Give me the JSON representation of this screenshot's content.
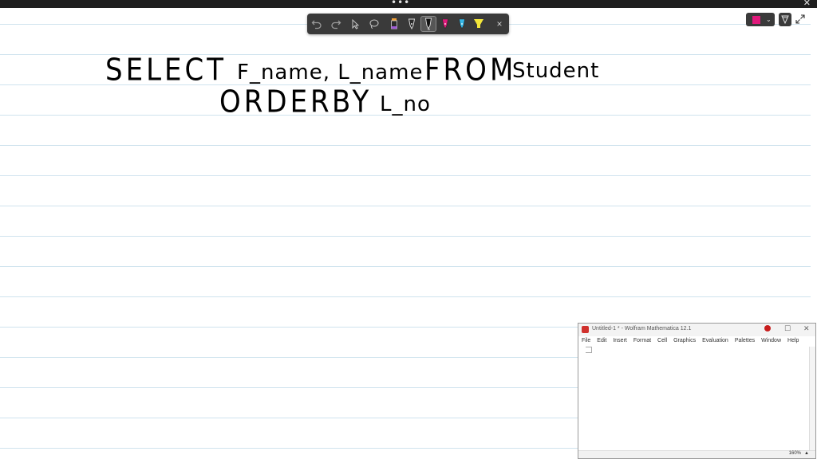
{
  "topbar": {
    "dots": "•••",
    "close": "✕"
  },
  "toolbar": {
    "tools": [
      "undo-icon",
      "redo-icon",
      "select-icon",
      "lasso-icon",
      "pen-orange-icon",
      "pen-black-outline-icon",
      "pen-black-icon",
      "pen-pink-icon",
      "pen-cyan-icon",
      "highlighter-yellow-icon"
    ],
    "close": "×"
  },
  "color_picker": {
    "selected_color": "#e0197b",
    "chevron": "⌄"
  },
  "ink": {
    "line1_select": "SELECT",
    "line1_fields": "F_name, L_name",
    "line1_from": "FROM",
    "line1_table": "Student",
    "line2_order": "ORDER",
    "line2_by": "BY",
    "line2_col": "L_no"
  },
  "mathematica": {
    "title": "Untitled-1 * - Wolfram Mathematica 12.1",
    "menus": [
      "File",
      "Edit",
      "Insert",
      "Format",
      "Cell",
      "Graphics",
      "Evaluation",
      "Palettes",
      "Window",
      "Help"
    ],
    "controls": {
      "minimize": "—",
      "maximize": "☐",
      "close": "✕"
    },
    "zoom": "160%",
    "zoom_arrow": "▲"
  }
}
